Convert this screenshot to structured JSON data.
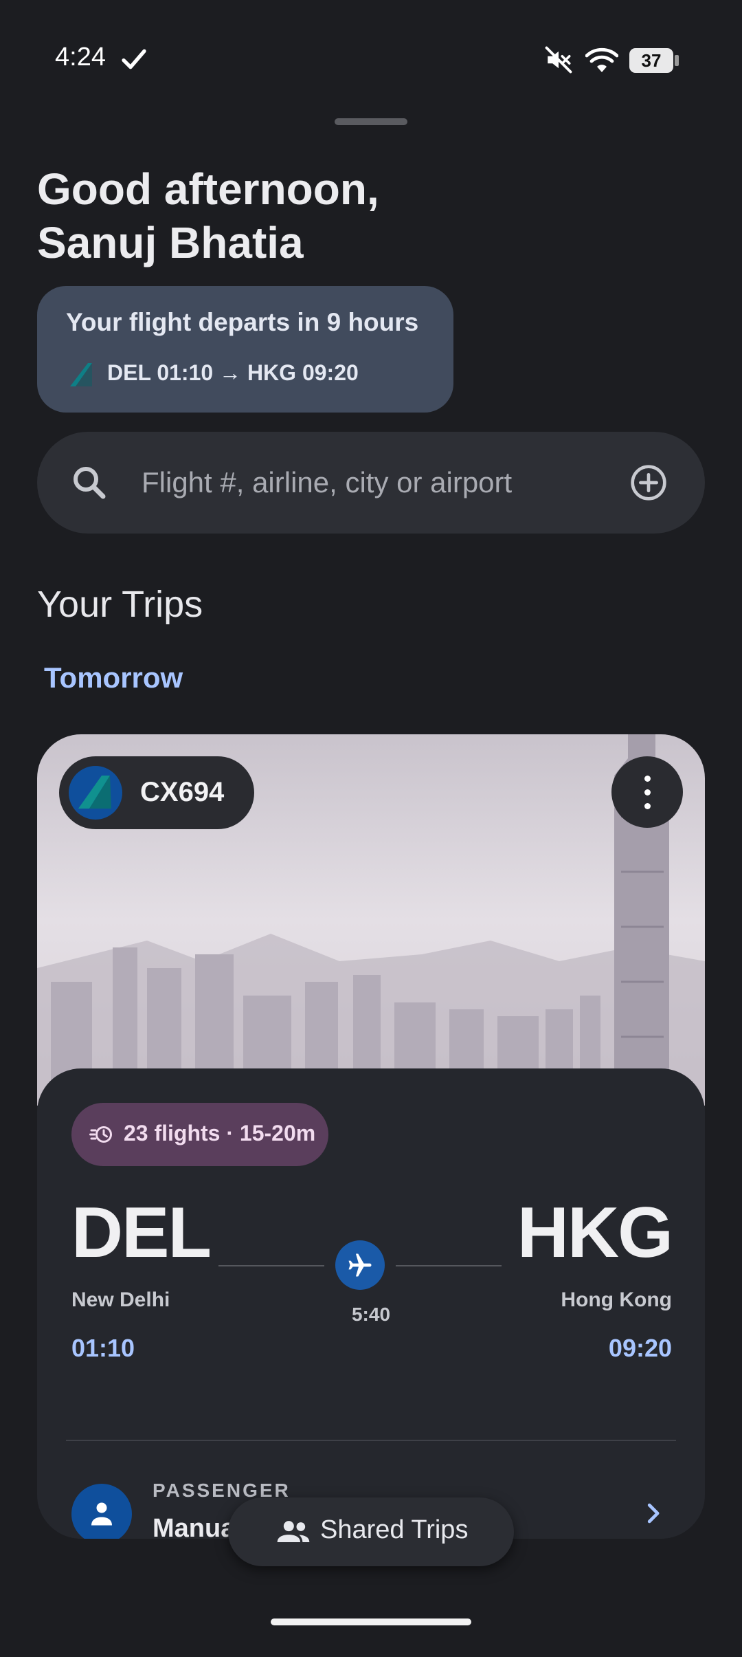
{
  "status_bar": {
    "time": "4:24",
    "battery": "37",
    "icons": [
      "check-icon",
      "mute-icon",
      "wifi-icon",
      "battery-icon"
    ]
  },
  "greeting": {
    "line1": "Good afternoon,",
    "line2": "Sanuj Bhatia"
  },
  "flight_banner": {
    "title": "Your flight departs in 9 hours",
    "route": "DEL 01:10 → HKG 09:20"
  },
  "search": {
    "placeholder": "Flight #, airline, city or airport",
    "icons": [
      "search-icon",
      "add-icon"
    ]
  },
  "trips": {
    "section_title": "Your Trips",
    "date_label": "Tomorrow",
    "card": {
      "flight_number": "CX694",
      "frequency": "23 flights · 15-20m",
      "origin": {
        "code": "DEL",
        "city": "New Delhi",
        "time": "01:10"
      },
      "destination": {
        "code": "HKG",
        "city": "Hong Kong",
        "time": "09:20"
      },
      "duration": "5:40",
      "passenger_label": "PASSENGER",
      "passenger_name": "Manual Flight"
    }
  },
  "bottom": {
    "shared_trips_label": "Shared Trips"
  },
  "colors": {
    "background": "#1c1d21",
    "accent": "#a8c5ff",
    "banner": "#414b5d",
    "badge": "#5a3e5c",
    "brand_blue": "#0f4f9c"
  }
}
